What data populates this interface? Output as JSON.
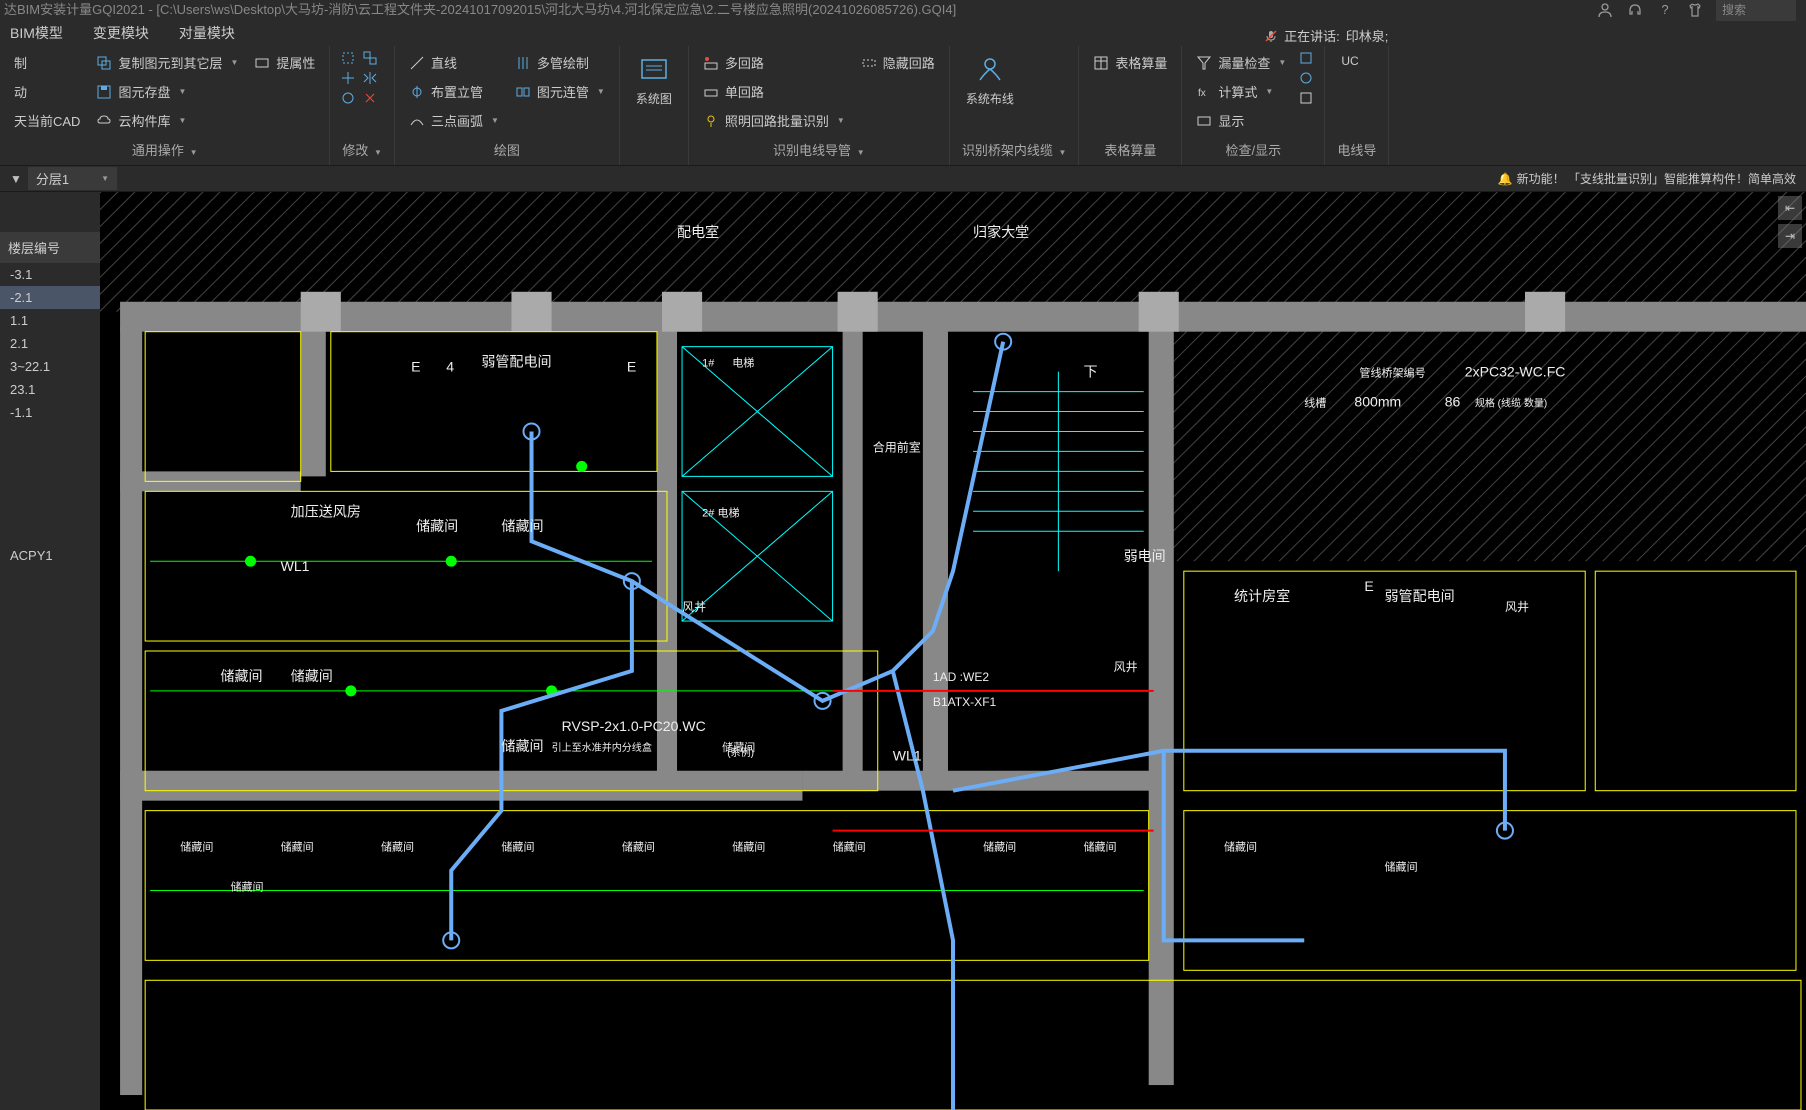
{
  "title": "达BIM安装计量GQI2021 - [C:\\Users\\ws\\Desktop\\大马坊-消防\\云工程文件夹-20241017092015\\河北大马坊\\4.河北保定应急\\2.二号楼应急照明(20241026085726).GQI4]",
  "search_placeholder": "搜索",
  "menu": {
    "bim_model": "BIM模型",
    "change_module": "变更模块",
    "quantity_module": "对量模块"
  },
  "ribbon": {
    "general": {
      "title": "通用操作",
      "copy_to_other": "复制图元到其它层",
      "set_property": "提属性",
      "save_element": "图元存盘",
      "cloud_lib": "云构件库",
      "control": "制",
      "move": "动",
      "as_cad": "天当前CAD"
    },
    "modify": {
      "title": "修改"
    },
    "draw": {
      "title": "绘图",
      "line": "直线",
      "place_vertical": "布置立管",
      "three_point_arc": "三点画弧",
      "multi_pipe": "多管绘制",
      "element_connect": "图元连管"
    },
    "system": {
      "system_diagram": "系统图"
    },
    "recognize": {
      "title": "识别电线导管",
      "multi_circuit": "多回路",
      "single_circuit": "单回路",
      "lighting_batch": "照明回路批量识别",
      "hidden_circuit": "隐藏回路"
    },
    "system_layout": {
      "label": "系统布线"
    },
    "bridge": {
      "title": "识别桥架内线缆"
    },
    "table": {
      "title": "表格算量",
      "table_calc": "表格算量"
    },
    "check": {
      "title": "检查/显示",
      "leak_check": "漏量检查",
      "calculation": "计算式",
      "display": "显示"
    },
    "wire": {
      "title": "电线导",
      "label": "UC"
    }
  },
  "speaking": {
    "label": "正在讲话:",
    "name": "印林泉;"
  },
  "layer": {
    "dropdown_label": "分层1"
  },
  "new_feature": "新功能！ 「支线批量识别」智能推算构件！简单高效",
  "floors": {
    "header": "楼层编号",
    "items": [
      "-3.1",
      "-2.1",
      "1.1",
      "2.1",
      "3~22.1",
      "23.1",
      "-1.1"
    ],
    "active_index": 1,
    "label2": "ACPY1"
  },
  "cad_labels": {
    "room1": "弱管配电间",
    "room2": "配电室",
    "room3": "归家大堂",
    "room4": "下",
    "room5": "电梯",
    "room5b": "2# 电梯",
    "room6": "加压送风房",
    "room7": "储藏间",
    "room8": "储藏间",
    "room9": "储藏间",
    "room10": "储藏间",
    "room11": "储藏间",
    "room12": "储藏间",
    "room13": "风井",
    "room14": "风井",
    "room15": "弱电间",
    "room16": "统计房室",
    "room17": "弱管配电间",
    "room18": "风井",
    "room19": "合用前室",
    "wire1": "WL1",
    "wire2": "WL1",
    "device1": "1AD :WE2",
    "device2": "B1ATX-XF1",
    "spec1": "RVSP-2x1.0-PC20.WC",
    "spec2": "2xPC32-WC.FC",
    "dim1": "800mm",
    "dim2": "86",
    "note1": "引上至水准并内分线盒",
    "note2": "管线桥架编号",
    "note3": "规格 (线缆 数量)",
    "note4": "(系例)",
    "note5": "线槽",
    "letter_e": "E",
    "num4": "4"
  }
}
